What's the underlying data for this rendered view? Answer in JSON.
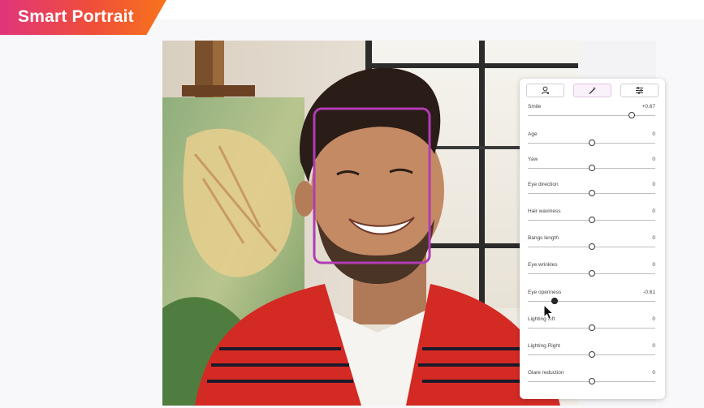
{
  "banner": {
    "title": "Smart Portrait"
  },
  "colors": {
    "banner_gradient": [
      "#e0357a",
      "#f04e3a",
      "#f8741c"
    ],
    "face_box": "#b23bb5",
    "jacket": "#d42a24"
  },
  "panel": {
    "tabs": [
      {
        "icon": "portrait-icon",
        "active": false
      },
      {
        "icon": "magic-wand-icon",
        "active": true
      },
      {
        "icon": "sliders-icon",
        "active": false
      }
    ],
    "sliders": [
      {
        "label": "Smile",
        "value": "+0.67",
        "level": 0.67
      },
      {
        "label": "Age",
        "value": "0",
        "level": 0
      },
      {
        "label": "Yaw",
        "value": "0",
        "level": 0
      },
      {
        "label": "Eye direction",
        "value": "0",
        "level": 0
      },
      {
        "label": "Hair waviness",
        "value": "0",
        "level": 0
      },
      {
        "label": "Bangs length",
        "value": "0",
        "level": 0
      },
      {
        "label": "Eye wrinkles",
        "value": "0",
        "level": 0
      },
      {
        "label": "Eye openness",
        "value": "-0.61",
        "level": -0.61
      },
      {
        "label": "Lighting left",
        "value": "0",
        "level": 0
      },
      {
        "label": "Lighting Right",
        "value": "0",
        "level": 0
      },
      {
        "label": "Glare reduction",
        "value": "0",
        "level": 0
      }
    ]
  }
}
